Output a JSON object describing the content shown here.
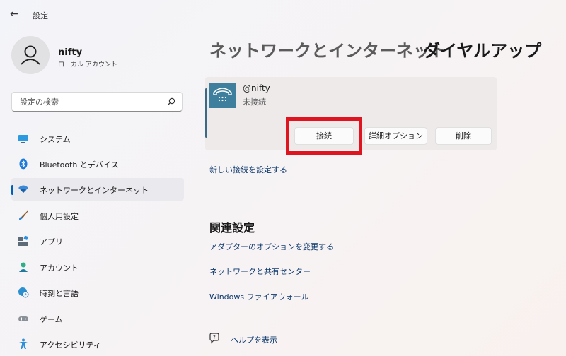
{
  "window": {
    "title": "設定",
    "back_icon": "back-arrow-icon"
  },
  "user": {
    "name": "nifty",
    "account_type": "ローカル アカウント"
  },
  "search": {
    "placeholder": "設定の検索"
  },
  "sidebar": {
    "items": [
      {
        "label": "システム",
        "icon": "display-icon",
        "selected": false
      },
      {
        "label": "Bluetooth とデバイス",
        "icon": "bluetooth-icon",
        "selected": false
      },
      {
        "label": "ネットワークとインターネット",
        "icon": "wifi-icon",
        "selected": true
      },
      {
        "label": "個人用設定",
        "icon": "brush-icon",
        "selected": false
      },
      {
        "label": "アプリ",
        "icon": "apps-icon",
        "selected": false
      },
      {
        "label": "アカウント",
        "icon": "person-icon",
        "selected": false
      },
      {
        "label": "時刻と言語",
        "icon": "globe-clock-icon",
        "selected": false
      },
      {
        "label": "ゲーム",
        "icon": "gamepad-icon",
        "selected": false
      },
      {
        "label": "アクセシビリティ",
        "icon": "accessibility-icon",
        "selected": false
      }
    ]
  },
  "breadcrumb": {
    "parent": "ネットワークとインターネット",
    "separator": "›",
    "current": "ダイヤルアップ"
  },
  "connection": {
    "name": "@nifty",
    "status": "未接続",
    "buttons": {
      "connect": "接続",
      "advanced": "詳細オプション",
      "delete": "削除"
    }
  },
  "new_connection_link": "新しい接続を設定する",
  "related": {
    "title": "関連設定",
    "links": [
      "アダプターのオプションを変更する",
      "ネットワークと共有センター",
      "Windows ファイアウォール"
    ]
  },
  "help": {
    "label": "ヘルプを表示"
  },
  "colors": {
    "accent": "#005fb8",
    "highlight": "#e0141e",
    "link": "#0f3a6e",
    "connection_icon_bg": "#3d7f9d"
  }
}
